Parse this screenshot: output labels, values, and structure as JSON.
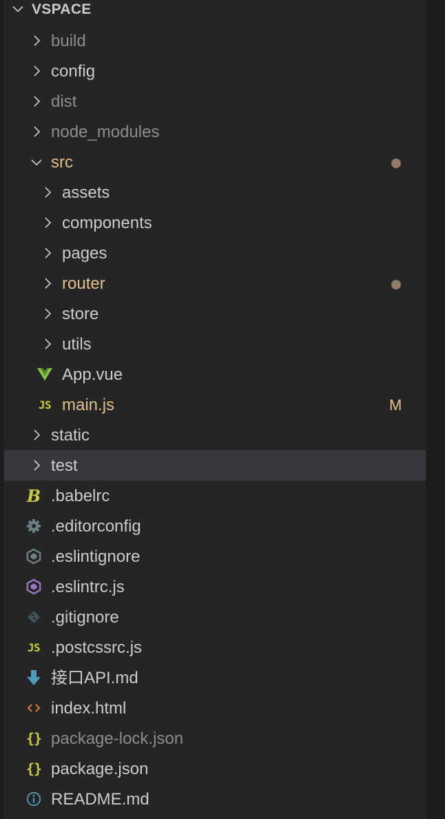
{
  "workspace": {
    "title": "VSPACE",
    "expanded": true
  },
  "tree": [
    {
      "name": "build",
      "kind": "folder",
      "depth": 0,
      "expanded": false,
      "color": "dim"
    },
    {
      "name": "config",
      "kind": "folder",
      "depth": 0,
      "expanded": false,
      "color": "normal"
    },
    {
      "name": "dist",
      "kind": "folder",
      "depth": 0,
      "expanded": false,
      "color": "dim"
    },
    {
      "name": "node_modules",
      "kind": "folder",
      "depth": 0,
      "expanded": false,
      "color": "dim"
    },
    {
      "name": "src",
      "kind": "folder",
      "depth": 0,
      "expanded": true,
      "color": "modified",
      "decoration": "dot"
    },
    {
      "name": "assets",
      "kind": "folder",
      "depth": 1,
      "expanded": false,
      "color": "normal"
    },
    {
      "name": "components",
      "kind": "folder",
      "depth": 1,
      "expanded": false,
      "color": "normal"
    },
    {
      "name": "pages",
      "kind": "folder",
      "depth": 1,
      "expanded": false,
      "color": "normal"
    },
    {
      "name": "router",
      "kind": "folder",
      "depth": 1,
      "expanded": false,
      "color": "modified",
      "decoration": "dot"
    },
    {
      "name": "store",
      "kind": "folder",
      "depth": 1,
      "expanded": false,
      "color": "normal"
    },
    {
      "name": "utils",
      "kind": "folder",
      "depth": 1,
      "expanded": false,
      "color": "normal"
    },
    {
      "name": "App.vue",
      "kind": "file",
      "depth": 1,
      "icon": "vue-icon",
      "color": "normal"
    },
    {
      "name": "main.js",
      "kind": "file",
      "depth": 1,
      "icon": "js-icon",
      "color": "modified",
      "badge": "M"
    },
    {
      "name": "static",
      "kind": "folder",
      "depth": 0,
      "expanded": false,
      "color": "normal"
    },
    {
      "name": "test",
      "kind": "folder",
      "depth": 0,
      "expanded": false,
      "color": "normal",
      "selected": true
    },
    {
      "name": ".babelrc",
      "kind": "file",
      "depth": 0,
      "icon": "babel-icon",
      "color": "normal"
    },
    {
      "name": ".editorconfig",
      "kind": "file",
      "depth": 0,
      "icon": "gear-icon",
      "color": "normal"
    },
    {
      "name": ".eslintignore",
      "kind": "file",
      "depth": 0,
      "icon": "eslint-gray-icon",
      "color": "normal"
    },
    {
      "name": ".eslintrc.js",
      "kind": "file",
      "depth": 0,
      "icon": "eslint-icon",
      "color": "normal"
    },
    {
      "name": ".gitignore",
      "kind": "file",
      "depth": 0,
      "icon": "git-icon",
      "color": "normal"
    },
    {
      "name": ".postcssrc.js",
      "kind": "file",
      "depth": 0,
      "icon": "js-icon",
      "color": "normal"
    },
    {
      "name": "接口API.md",
      "kind": "file",
      "depth": 0,
      "icon": "markdown-download-icon",
      "color": "normal"
    },
    {
      "name": "index.html",
      "kind": "file",
      "depth": 0,
      "icon": "html-icon",
      "color": "normal"
    },
    {
      "name": "package-lock.json",
      "kind": "file",
      "depth": 0,
      "icon": "json-icon",
      "color": "dim"
    },
    {
      "name": "package.json",
      "kind": "file",
      "depth": 0,
      "icon": "json-icon",
      "color": "normal"
    },
    {
      "name": "README.md",
      "kind": "file",
      "depth": 0,
      "icon": "info-icon",
      "color": "normal"
    }
  ],
  "colors": {
    "background": "#252526",
    "text": "#cccccc",
    "dim_text": "#8c8c8c",
    "modified_text": "#e2c08d",
    "selected_row": "#37373d",
    "dot": "#8f7b66"
  }
}
